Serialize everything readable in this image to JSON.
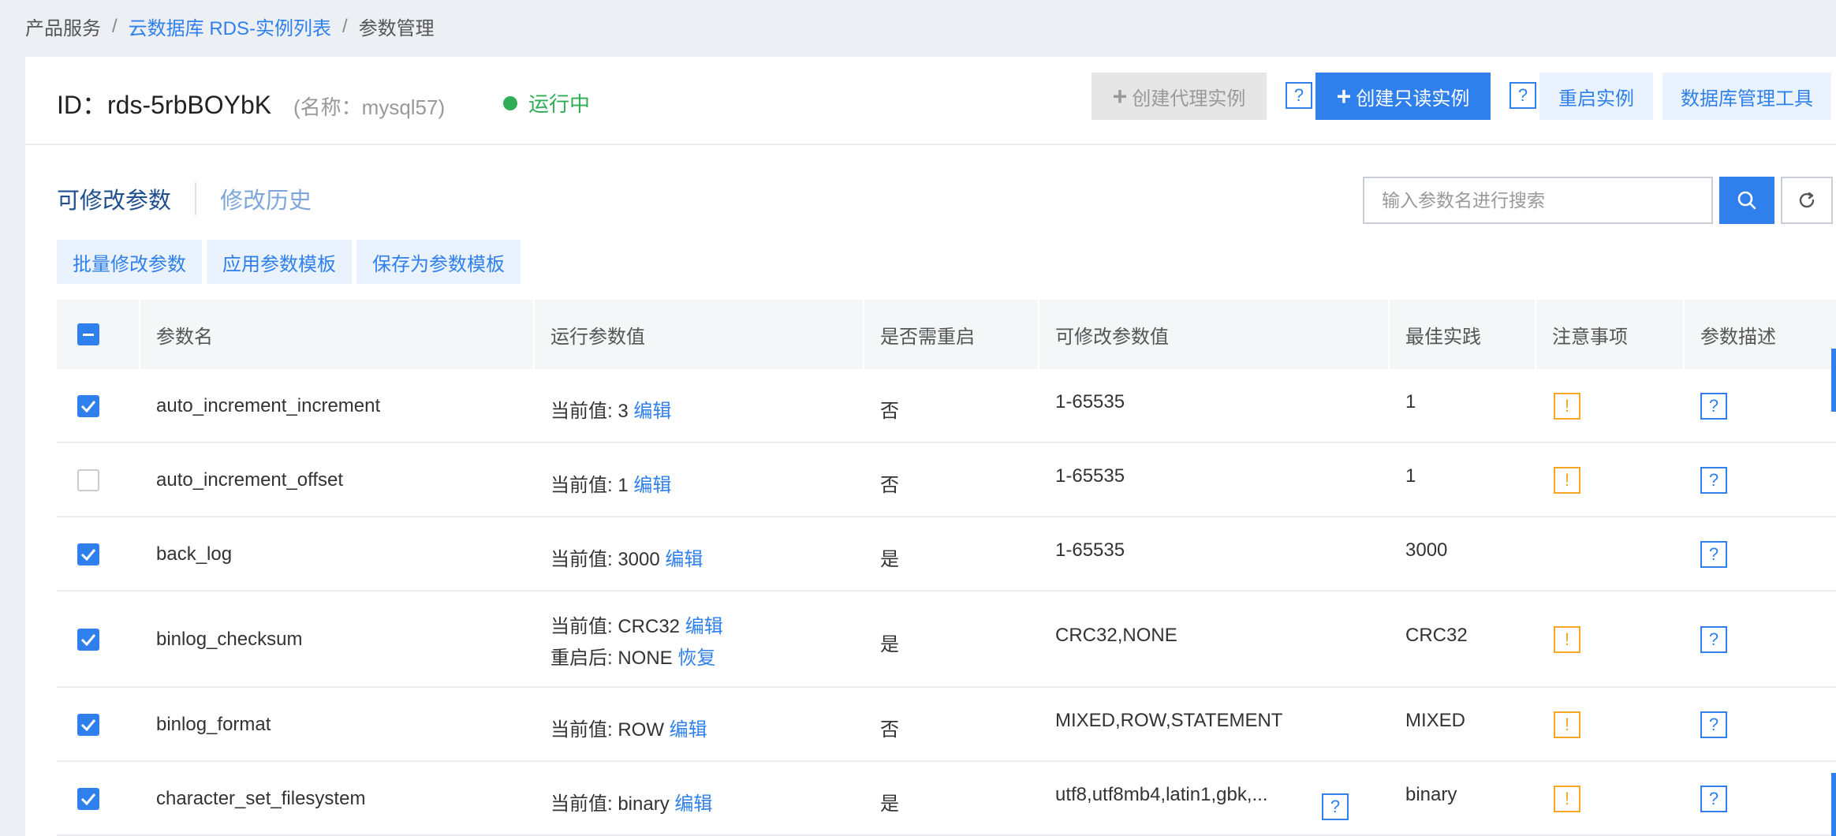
{
  "breadcrumb": {
    "item1": "产品服务",
    "sep1": "/",
    "item2": "云数据库 RDS-实例列表",
    "sep2": "/",
    "item3": "参数管理"
  },
  "header": {
    "id": "ID：rds-5rbBOYbK",
    "name": "(名称：mysql57)",
    "status": "运行中",
    "btn_proxy": "创建代理实例",
    "btn_readonly": "创建只读实例",
    "btn_restart": "重启实例",
    "btn_dbtool": "数据库管理工具",
    "help": "?",
    "plus": "+"
  },
  "tabs": {
    "editable": "可修改参数",
    "history": "修改历史"
  },
  "search": {
    "placeholder": "输入参数名进行搜索"
  },
  "actions": {
    "batch": "批量修改参数",
    "apply_template": "应用参数模板",
    "save_template": "保存为参数模板"
  },
  "table": {
    "columns": {
      "name": "参数名",
      "running": "运行参数值",
      "restart": "是否需重启",
      "range": "可修改参数值",
      "best": "最佳实践",
      "notes": "注意事项",
      "desc": "参数描述"
    },
    "edit_label": "编辑",
    "restore_label": "恢复",
    "warn_symbol": "!",
    "help_symbol": "?",
    "rows": [
      {
        "checked": true,
        "name": "auto_increment_increment",
        "current": "当前值: 3",
        "after": "",
        "restart": "否",
        "range": "1-65535",
        "best": "1",
        "notes": true
      },
      {
        "checked": false,
        "name": "auto_increment_offset",
        "current": "当前值: 1",
        "after": "",
        "restart": "否",
        "range": "1-65535",
        "best": "1",
        "notes": true
      },
      {
        "checked": true,
        "name": "back_log",
        "current": "当前值: 3000",
        "after": "",
        "restart": "是",
        "range": "1-65535",
        "best": "3000",
        "notes": false
      },
      {
        "checked": true,
        "name": "binlog_checksum",
        "current": "当前值: CRC32",
        "after": "重启后: NONE",
        "restart": "是",
        "range": "CRC32,NONE",
        "best": "CRC32",
        "notes": true
      },
      {
        "checked": true,
        "name": "binlog_format",
        "current": "当前值: ROW",
        "after": "",
        "restart": "否",
        "range": "MIXED,ROW,STATEMENT",
        "best": "MIXED",
        "notes": true
      },
      {
        "checked": true,
        "name": "character_set_filesystem",
        "current": "当前值: binary",
        "after": "",
        "restart": "是",
        "range": "utf8,utf8mb4,latin1,gbk,...",
        "best": "binary",
        "notes": true
      }
    ]
  },
  "colors": {
    "primary": "#2f80ed",
    "success": "#2fae56",
    "warning": "#f5a623"
  }
}
